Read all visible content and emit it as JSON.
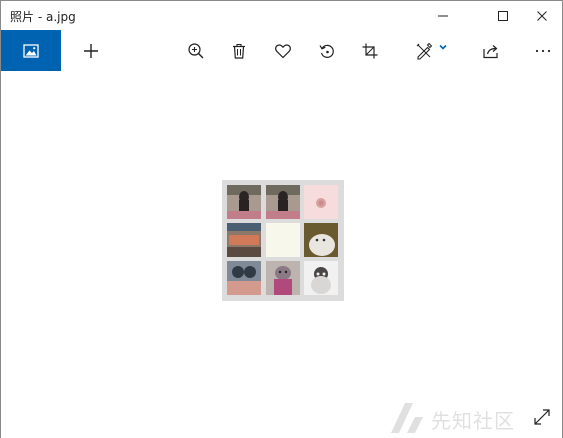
{
  "window": {
    "title": "照片 - a.jpg"
  },
  "toolbar": {
    "accent_color": "#0063b1",
    "buttons": [
      {
        "name": "home",
        "icon": "photos-home-icon"
      },
      {
        "name": "add",
        "icon": "plus-icon"
      },
      {
        "name": "zoom",
        "icon": "zoom-in-icon"
      },
      {
        "name": "delete",
        "icon": "trash-icon"
      },
      {
        "name": "favorite",
        "icon": "heart-icon"
      },
      {
        "name": "rotate",
        "icon": "rotate-icon"
      },
      {
        "name": "crop",
        "icon": "crop-icon"
      },
      {
        "name": "edit",
        "icon": "edit-draw-icon"
      },
      {
        "name": "share",
        "icon": "share-icon"
      },
      {
        "name": "more",
        "icon": "more-icon"
      }
    ]
  },
  "watermark": {
    "text": "先知社区"
  }
}
